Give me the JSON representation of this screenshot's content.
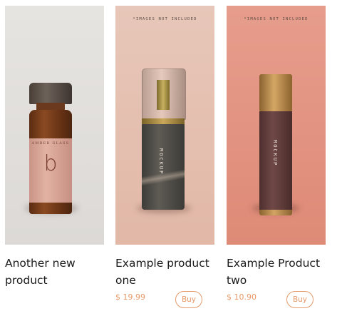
{
  "products": [
    {
      "title_line1": "Another new",
      "title_line2": "product",
      "image": {
        "bottle_brand": "AMBER GLASS",
        "bottle_letter": "b"
      }
    },
    {
      "title_line1": "Example product",
      "title_line2": "one",
      "price": "$ 19.99",
      "buy_label": "Buy",
      "image": {
        "notice": "*IMAGES NOT INCLUDED",
        "bottle_text": "MOCKUP"
      }
    },
    {
      "title_line1": "Example Product",
      "title_line2": "two",
      "price": "$ 10.90",
      "buy_label": "Buy",
      "image": {
        "notice": "*IMAGES NOT INCLUDED",
        "bottle_text": "MOCKUP"
      }
    }
  ],
  "colors": {
    "accent": "#e59a6a",
    "card1_bg": "#e2dfdc",
    "card2_bg": "#e5c1b2",
    "card3_bg": "#e39684"
  }
}
